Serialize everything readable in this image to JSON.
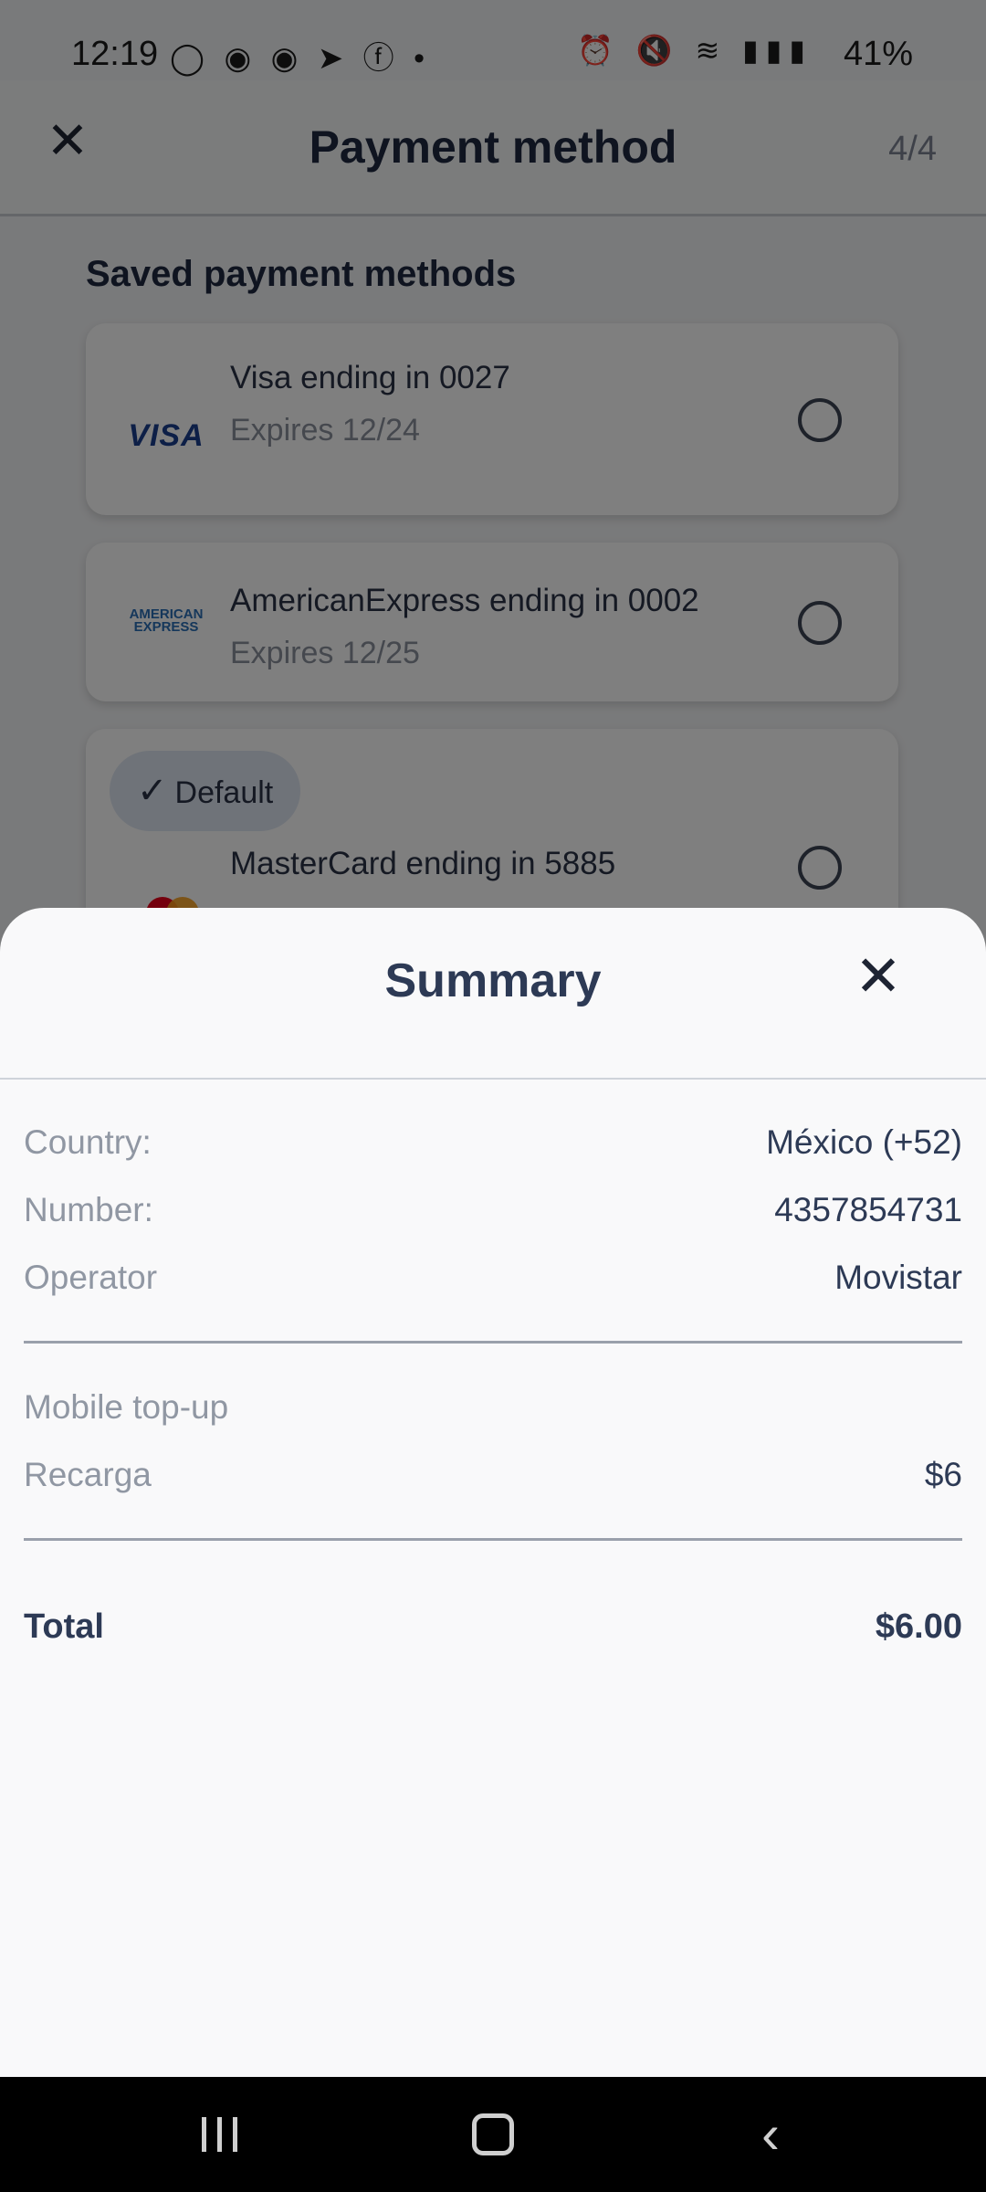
{
  "status_bar": {
    "time": "12:19",
    "left_icons": "◯ ◉ ◉ ➤ ⓕ •",
    "right_icons": "⏰ 🔇 ≋ ▮▮▮",
    "battery": "41%"
  },
  "app_bar": {
    "title": "Payment method",
    "step": "4/4"
  },
  "saved_methods": {
    "section_title": "Saved payment methods",
    "cards": [
      {
        "logo": "VISA",
        "name": "Visa ending in 0027",
        "expires": "Expires 12/24",
        "selected": false
      },
      {
        "logo": "AMERICAN EXPRESS",
        "name": "AmericanExpress ending in 0002",
        "expires": "Expires 12/25",
        "selected": false
      },
      {
        "badge": "Default",
        "name": "MasterCard ending in 5885",
        "selected": false
      }
    ]
  },
  "summary": {
    "title": "Summary",
    "details": [
      {
        "label": "Country:",
        "value": "México (+52)"
      },
      {
        "label": "Number:",
        "value": "4357854731"
      },
      {
        "label": "Operator",
        "value": "Movistar"
      }
    ],
    "product_heading": "Mobile top-up",
    "product": {
      "label": "Recarga",
      "value": "$6"
    },
    "total": {
      "label": "Total",
      "value": "$6.00"
    }
  },
  "colors": {
    "text_primary": "#2d3a55",
    "text_secondary": "#9097a3",
    "badge_bg": "#dfe6f2",
    "visa_blue": "#1a3f8f",
    "amex_blue": "#2b6fb6",
    "mastercard_red": "#eb001b",
    "mastercard_orange": "#f79e1b"
  }
}
